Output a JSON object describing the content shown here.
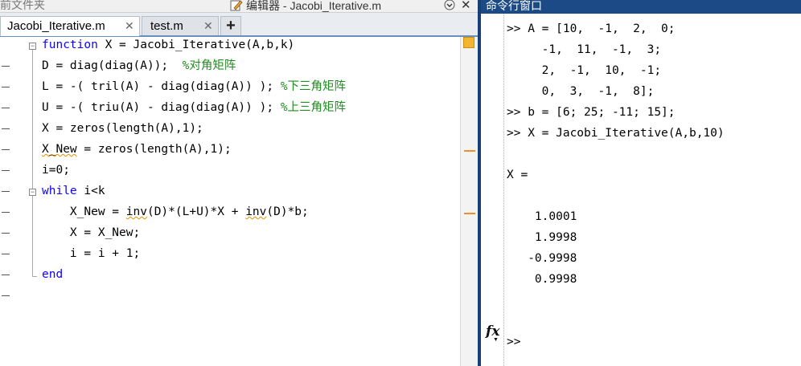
{
  "editor": {
    "folder_title": "前文件夹",
    "title": "编辑器 - Jacobi_Iterative.m",
    "tabs": [
      {
        "label": "Jacobi_Iterative.m",
        "close": "✕",
        "active": true
      },
      {
        "label": "test.m",
        "close": "✕",
        "active": false
      }
    ],
    "add_tab": "+",
    "code_lines": [
      [
        {
          "t": "function",
          "k": "kw"
        },
        {
          "t": " X = Jacobi_Iterative(A,b,k)"
        }
      ],
      [
        {
          "t": "D = diag(diag(A));  "
        },
        {
          "t": "%对角矩阵",
          "k": "cm"
        }
      ],
      [
        {
          "t": "L = -( tril(A) - diag(diag(A)) ); "
        },
        {
          "t": "%下三角矩阵",
          "k": "cm"
        }
      ],
      [
        {
          "t": "U = -( triu(A) - diag(diag(A)) ); "
        },
        {
          "t": "%上三角矩阵",
          "k": "cm"
        }
      ],
      [
        {
          "t": "X = zeros(length(A),1);"
        }
      ],
      [
        {
          "t": "X_New",
          "k": "warn"
        },
        {
          "t": " = zeros(length(A),1);"
        }
      ],
      [
        {
          "t": "i=0;"
        }
      ],
      [
        {
          "t": "while",
          "k": "kw"
        },
        {
          "t": " i<k"
        }
      ],
      [
        {
          "t": "    X_New = "
        },
        {
          "t": "inv",
          "k": "warn"
        },
        {
          "t": "(D)*(L+U)*X + "
        },
        {
          "t": "inv",
          "k": "warn"
        },
        {
          "t": "(D)*b;"
        }
      ],
      [
        {
          "t": "    X = X_New;"
        }
      ],
      [
        {
          "t": "    i = i + 1;"
        }
      ],
      [
        {
          "t": "end",
          "k": "kw"
        }
      ]
    ]
  },
  "command_window": {
    "title": "命令行窗口",
    "lines": [
      ">> A = [10,  -1,  2,  0;",
      "     -1,  11,  -1,  3;",
      "     2,  -1,  10,  -1;",
      "     0,  3,  -1,  8];",
      ">> b = [6; 25; -11; 15];",
      ">> X = Jacobi_Iterative(A,b,10)",
      "",
      "X =",
      "",
      "    1.0001",
      "    1.9998",
      "   -0.9998",
      "    0.9998",
      "",
      "",
      ">>"
    ],
    "fx_icon": "fx",
    "fx_arrow": "▼"
  },
  "icons": {
    "edit": "edit-icon",
    "dropdown": "chevron-down-icon",
    "close": "close-icon"
  },
  "colors": {
    "keyword": "#0e00ff",
    "comment": "#228b22",
    "warning": "#f09020",
    "cmd_title_bg": "#1c4a86"
  }
}
